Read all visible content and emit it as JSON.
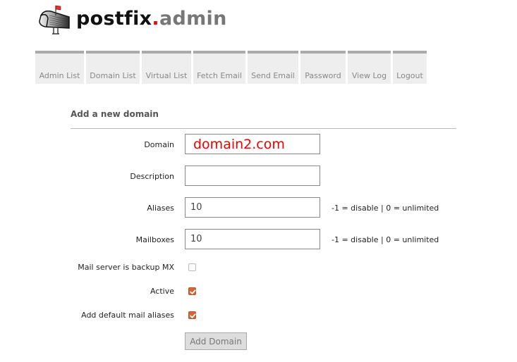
{
  "logo": {
    "part1": "postfix",
    "dot": ".",
    "part2": "admin",
    "icon": "mailbox-icon"
  },
  "menu": [
    {
      "label": "Admin List"
    },
    {
      "label": "Domain List"
    },
    {
      "label": "Virtual List"
    },
    {
      "label": "Fetch Email"
    },
    {
      "label": "Send Email"
    },
    {
      "label": "Password"
    },
    {
      "label": "View Log"
    },
    {
      "label": "Logout"
    }
  ],
  "form": {
    "title": "Add a new domain",
    "domain": {
      "label": "Domain",
      "value": "domain2.com"
    },
    "description": {
      "label": "Description",
      "value": ""
    },
    "aliases": {
      "label": "Aliases",
      "value": "10",
      "hint": "-1 = disable | 0 = unlimited"
    },
    "mailboxes": {
      "label": "Mailboxes",
      "value": "10",
      "hint": "-1 = disable | 0 = unlimited"
    },
    "backup_mx": {
      "label": "Mail server is backup MX",
      "checked": false
    },
    "active": {
      "label": "Active",
      "checked": true
    },
    "default_aliases": {
      "label": "Add default mail aliases",
      "checked": true
    },
    "submit_label": "Add Domain"
  },
  "colors": {
    "accent_checkbox": "#d0683a",
    "logo_dot": "#dd1111",
    "domain_value": "#ee0000"
  }
}
